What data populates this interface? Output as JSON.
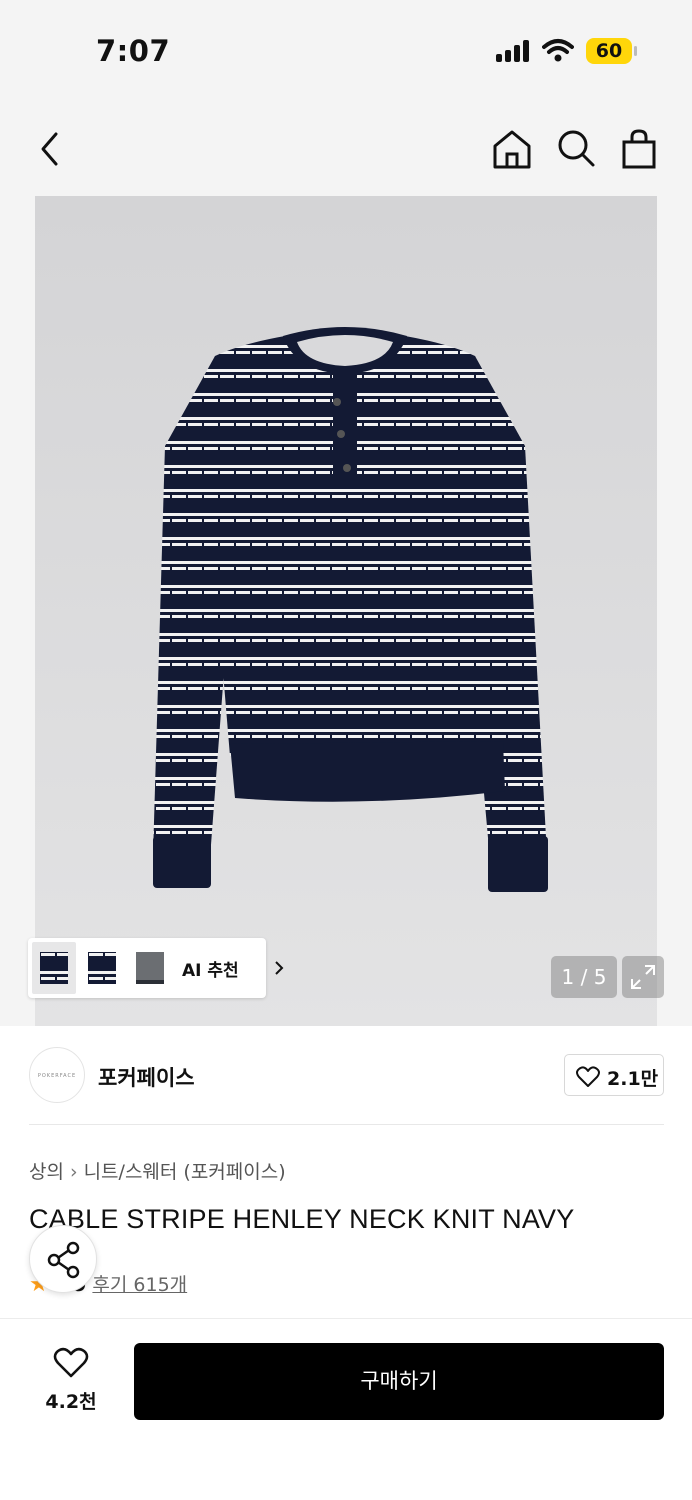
{
  "status_bar": {
    "time": "7:07",
    "battery": "60"
  },
  "nav": {
    "icons": [
      "back-icon",
      "home-icon",
      "search-icon",
      "bag-icon"
    ]
  },
  "gallery": {
    "ai_label": "AI 추천",
    "pager": "1 / 5",
    "thumbnails": [
      "navy-white stripe knit",
      "navy-white stripe knit alt",
      "grey stripe knit"
    ]
  },
  "brand": {
    "logo_text": "POKERFACE",
    "name": "포커페이스",
    "likes": "2.1만"
  },
  "product": {
    "breadcrumb": [
      "상의",
      "니트/스웨터 (포커페이스)"
    ],
    "title": "CABLE STRIPE HENLEY NECK KNIT NAVY",
    "rating": "4.9",
    "reviews": "후기 615개"
  },
  "bottom_bar": {
    "wish_count": "4.2천",
    "buy_label": "구매하기"
  },
  "colors": {
    "accent_star": "#ff9f1a",
    "battery": "#ffd60a",
    "buy_button": "#000000",
    "sweater_navy": "#131a34"
  }
}
